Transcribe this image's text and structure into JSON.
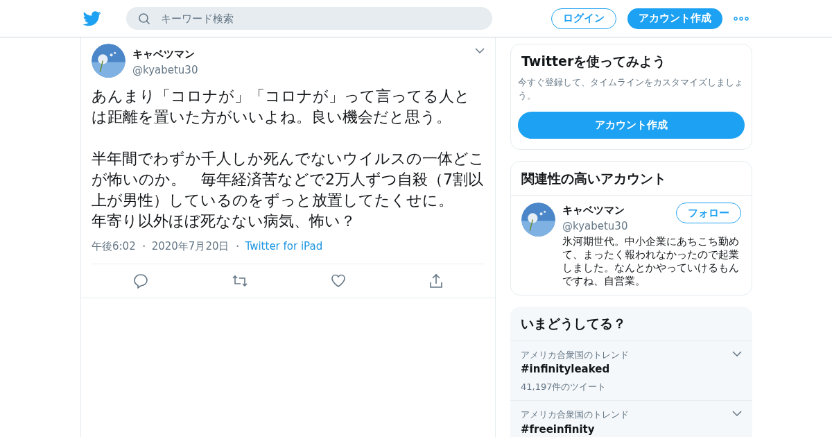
{
  "header": {
    "search": {
      "placeholder": "キーワード検索"
    },
    "login": "ログイン",
    "signup": "アカウント作成"
  },
  "tweet": {
    "name": "キャベツマン",
    "handle": "@kyabetu30",
    "paragraphs": [
      [
        "あんまり「コロナが」「コロナが」って言ってる人とは距離を置いた方がいいよね。良い機会だと思う。"
      ],
      [
        "半年間でわずか千人しか死んでないウイルスの一体どこが怖いのか。　毎年経済苦などで2万人ずつ自殺（7割以上が男性）しているのをずっと放置してたくせに。",
        "年寄り以外ほぼ死なない病気、怖い？"
      ]
    ],
    "time": "午後6:02",
    "separator": "・",
    "date": "2020年7月20日",
    "source": "Twitter for iPad"
  },
  "signup_card": {
    "title": "Twitterを使ってみよう",
    "text": "今すぐ登録して、タイムラインをカスタマイズしましょう。",
    "button": "アカウント作成"
  },
  "related": {
    "title": "関連性の高いアカウント",
    "accounts": [
      {
        "name": "キャベツマン",
        "handle": "@kyabetu30",
        "follow": "フォロー",
        "bio": "氷河期世代。中小企業にあちこち勤めて、まったく報われなかったので起業しました。なんとかやっていけるもんですね、自営業。"
      }
    ]
  },
  "trends": {
    "title": "いまどうしてる？",
    "items": [
      {
        "context": "アメリカ合衆国のトレンド",
        "tag": "#infinityleaked",
        "count": "41,197件のツイート"
      },
      {
        "context": "アメリカ合衆国のトレンド",
        "tag": "#freeinfinity"
      }
    ]
  }
}
